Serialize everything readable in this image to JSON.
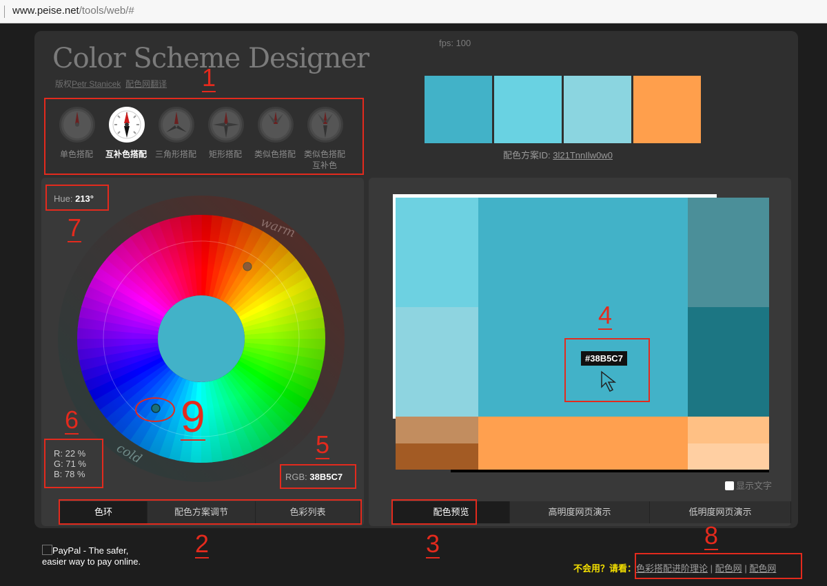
{
  "browser": {
    "url_host": "www.peise.net",
    "url_path": "/tools/web/#"
  },
  "header": {
    "fps": "fps: 100",
    "title": "Color Scheme Designer",
    "copyright_prefix": "版权",
    "author": "Petr Stanicek",
    "translation": "配色网翻译"
  },
  "scheme_types": [
    {
      "label": "单色搭配",
      "active": false
    },
    {
      "label": "互补色搭配",
      "active": true
    },
    {
      "label": "三角形搭配",
      "active": false
    },
    {
      "label": "矩形搭配",
      "active": false
    },
    {
      "label": "类似色搭配",
      "active": false
    },
    {
      "label": "类似色搭配互补色",
      "active": false
    }
  ],
  "palette": {
    "swatches": [
      "#42b2c8",
      "#69d2e2",
      "#8bd5e0",
      "#ff9f4c"
    ],
    "scheme_id_label": "配色方案ID:",
    "scheme_id": "3l21TnnIlw0w0"
  },
  "color_wheel": {
    "hue_label": "Hue:",
    "hue_value": "213°",
    "warm_label": "warm",
    "cold_label": "cold",
    "r": "R: 22 %",
    "g": "G: 71 %",
    "b": "B: 78 %",
    "rgb_label": "RGB:",
    "rgb_value": "38B5C7",
    "center_color": "#42b2c8"
  },
  "left_tabs": [
    "色环",
    "配色方案调节",
    "色彩列表"
  ],
  "right_tabs": [
    "配色预览",
    "高明度网页演示",
    "低明度网页演示"
  ],
  "preview": {
    "hex_label": "#38B5C7",
    "show_text_label": "显示文字",
    "colors": {
      "main": "#42b2c8",
      "light1": "#6dd1e1",
      "light2": "#8ed4e0",
      "dark1": "#4b8f99",
      "dark2": "#1c7683",
      "orange": "#ffa04f",
      "orange_light1": "#ffc084",
      "orange_light2": "#ffcfa2",
      "brown1": "#c28d5f",
      "brown2": "#a35b24"
    }
  },
  "footer": {
    "paypal_alt": "PayPal - The safer, easier way to pay online.",
    "prompt": "不会用？请看：",
    "link1": "色彩搭配进阶理论",
    "sep": "|",
    "link2": "配色网",
    "link3": "配色网"
  },
  "annotations": [
    "1",
    "2",
    "3",
    "4",
    "5",
    "6",
    "7",
    "8",
    "9"
  ],
  "accent_red": "#e42a1d"
}
